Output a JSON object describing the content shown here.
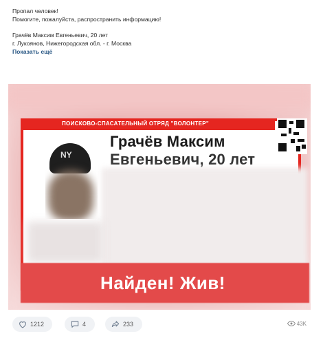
{
  "post": {
    "line1": "Пропал человек!",
    "line2": "Помогите, пожалуйста, распространить информацию!",
    "line3": "Грачёв Максим Евгеньевич, 20 лет",
    "line4": "г. Лукоянов, Нижегородская обл. - г. Москва",
    "show_more": "Показать ещё"
  },
  "image": {
    "org": "ПОИСКОВО-СПАСАТЕЛЬНЫЙ ОТРЯД \"ВОЛОНТЕР\"",
    "name_line1": "Грачёв Максим",
    "name_line2": "Евгеньевич, 20 лет",
    "status": "Найден! Жив!",
    "cap_logo": "NY",
    "accent_color": "#e52620"
  },
  "actions": {
    "likes": "1212",
    "comments": "4",
    "shares": "233",
    "views": "43K"
  },
  "icons": {
    "like": "heart-icon",
    "comment": "comment-icon",
    "share": "share-icon",
    "views": "eye-icon",
    "qr": "qr-code-icon"
  }
}
